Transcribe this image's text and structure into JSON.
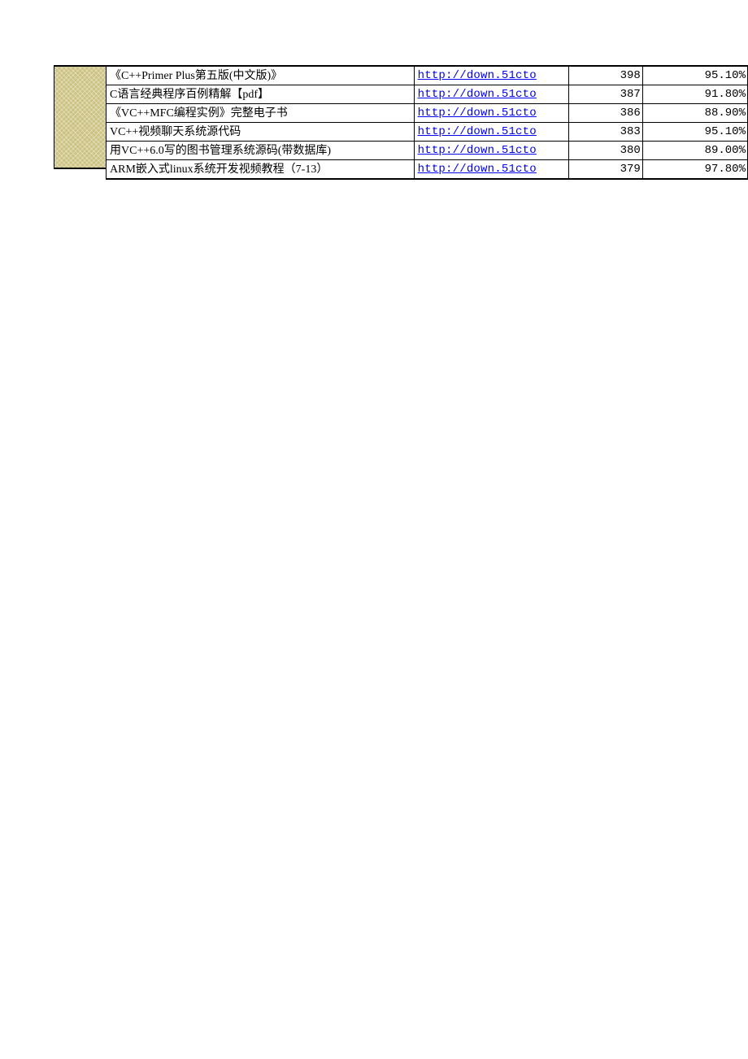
{
  "rows": [
    {
      "title": "《C++Primer Plus第五版(中文版)》",
      "link": "http://down.51cto",
      "count": "398",
      "pct": "95.10%"
    },
    {
      "title": "C语言经典程序百例精解【pdf】",
      "link": "http://down.51cto",
      "count": "387",
      "pct": "91.80%"
    },
    {
      "title": "《VC++MFC编程实例》完整电子书",
      "link": "http://down.51cto",
      "count": "386",
      "pct": "88.90%"
    },
    {
      "title": "VC++视频聊天系统源代码",
      "link": "http://down.51cto",
      "count": "383",
      "pct": "95.10%"
    },
    {
      "title": "用VC++6.0写的图书管理系统源码(带数据库)",
      "link": "http://down.51cto",
      "count": "380",
      "pct": "89.00%"
    },
    {
      "title": "ARM嵌入式linux系统开发视频教程（7-13）",
      "link": "http://down.51cto",
      "count": "379",
      "pct": "97.80%"
    }
  ]
}
